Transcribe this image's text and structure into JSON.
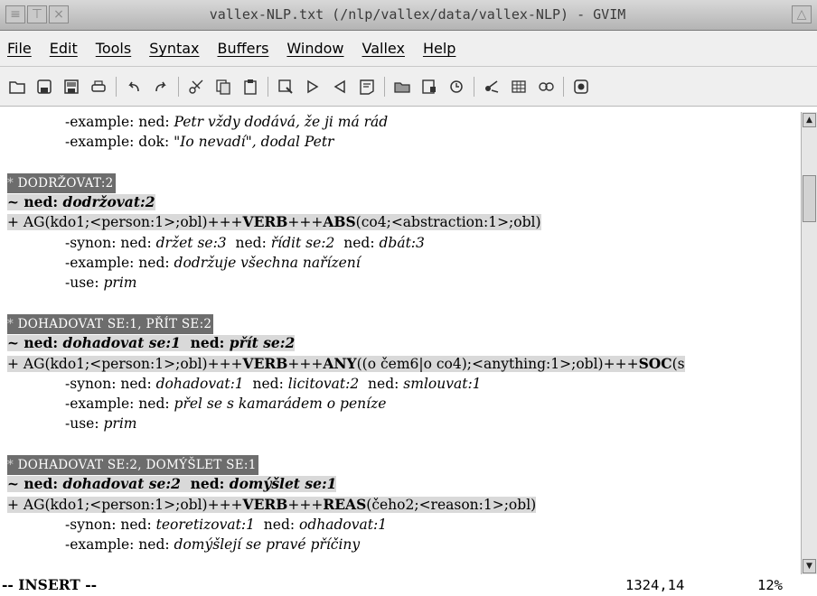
{
  "window": {
    "title": "vallex-NLP.txt (/nlp/vallex/data/vallex-NLP) - GVIM",
    "buttons": [
      "≡",
      "⊤",
      "×"
    ],
    "right_button": "△"
  },
  "menu": [
    "File",
    "Edit",
    "Tools",
    "Syntax",
    "Buffers",
    "Window",
    "Vallex",
    "Help"
  ],
  "toolbar_icons": [
    "open-icon",
    "save-icon",
    "save-all-icon",
    "print-icon",
    "undo-icon",
    "redo-icon",
    "cut-icon",
    "copy-icon",
    "paste-icon",
    "find-icon",
    "find-next-icon",
    "find-prev-icon",
    "load-session-icon",
    "save-session-icon",
    "run-script-icon",
    "make-icon",
    "shell-icon",
    "ctags-icon",
    "split-icon",
    "help-icon"
  ],
  "editor": {
    "l1": {
      "pre": "-example: ned: ",
      "it": "Petr vždy dodává, že ji má rád"
    },
    "l2": {
      "pre": "-example: dok: ",
      "it": "\"Io nevadí\", dodal Petr"
    },
    "b1": {
      "head": "DODRŽOVAT:2",
      "lemma_pre": "~ ned: ",
      "lemma": "dodržovat:2",
      "frame_a": "+ AG(kdo1;<person:1>;obl)+++",
      "frame_b": "VERB",
      "frame_c": "+++",
      "frame_d": "ABS",
      "frame_e": "(co4;<abstraction:1>;obl)",
      "syn_pre": "-synon: ned: ",
      "syn1": "držet se:3",
      "syn_mid1": "  ned: ",
      "syn2": "řídit se:2",
      "syn_mid2": "  ned: ",
      "syn3": "dbát:3",
      "ex_pre": "-example: ned: ",
      "ex": "dodržuje všechna nařízení",
      "use_pre": "-use: ",
      "use": "prim"
    },
    "b2": {
      "head": "DOHADOVAT SE:1, PŘÍT SE:2",
      "lemma_pre": "~ ned: ",
      "lemma1": "dohadovat se:1",
      "lemma_mid": "  ned: ",
      "lemma2": "přít se:2",
      "frame_a": "+ AG(kdo1;<person:1>;obl)+++",
      "frame_b": "VERB",
      "frame_c": "+++",
      "frame_d": "ANY",
      "frame_e": "((o čem6|o co4);<anything:1>;obl)+++",
      "frame_f": "SOC",
      "frame_g": "(s",
      "syn_pre": "-synon: ned: ",
      "syn1": "dohadovat:1",
      "syn_mid1": "  ned: ",
      "syn2": "licitovat:2",
      "syn_mid2": "  ned: ",
      "syn3": "smlouvat:1",
      "ex_pre": "-example: ned: ",
      "ex": "přel se s kamarádem o peníze",
      "use_pre": "-use: ",
      "use": "prim"
    },
    "b3": {
      "head": "DOHADOVAT SE:2, DOMÝŠLET SE:1",
      "lemma_pre": "~ ned: ",
      "lemma1": "dohadovat se:2",
      "lemma_mid": "  ned: ",
      "lemma2": "domýšlet se:1",
      "frame_a": "+ AG(kdo1;<person:1>;obl)+++",
      "frame_b": "VERB",
      "frame_c": "+++",
      "frame_d": "REAS",
      "frame_e": "(čeho2;<reason:1>;obl)",
      "syn_pre": "-synon: ned: ",
      "syn1": "teoretizovat:1",
      "syn_mid1": "  ned: ",
      "syn2": "odhadovat:1",
      "ex_pre": "-example: ned: ",
      "ex": "domýšlejí se pravé příčiny"
    }
  },
  "status": {
    "mode": "-- INSERT --",
    "position": "1324,14",
    "percent": "12%"
  }
}
